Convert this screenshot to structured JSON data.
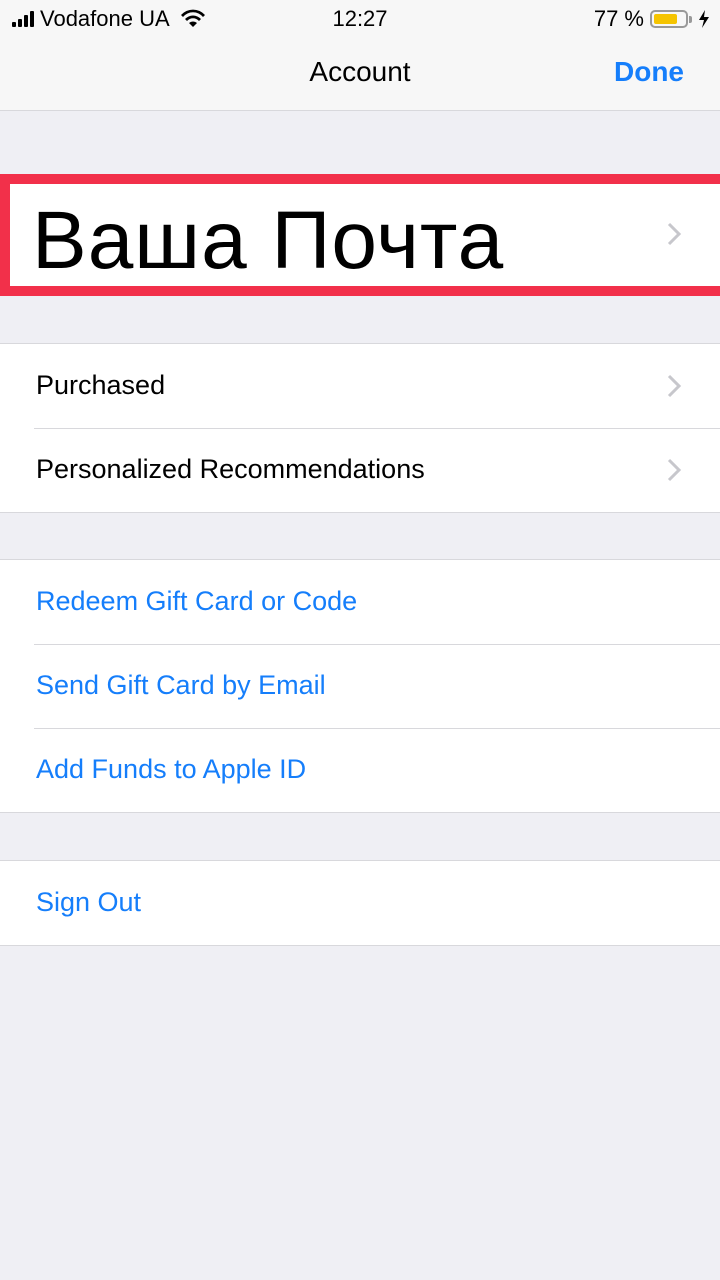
{
  "status_bar": {
    "carrier": "Vodafone UA",
    "time": "12:27",
    "battery_percent_text": "77 %",
    "battery_level": 0.77,
    "battery_color": "#f5c400"
  },
  "nav": {
    "title": "Account",
    "done_label": "Done"
  },
  "account": {
    "name": "Ваша Почта",
    "highlight_color": "#f2304a"
  },
  "groups": [
    {
      "items": [
        {
          "label": "Purchased",
          "style": "default",
          "chevron": true
        },
        {
          "label": "Personalized Recommendations",
          "style": "default",
          "chevron": true
        }
      ]
    },
    {
      "items": [
        {
          "label": "Redeem Gift Card or Code",
          "style": "link"
        },
        {
          "label": "Send Gift Card by Email",
          "style": "link"
        },
        {
          "label": "Add Funds to Apple ID",
          "style": "link"
        }
      ]
    },
    {
      "items": [
        {
          "label": "Sign Out",
          "style": "link"
        }
      ]
    }
  ],
  "colors": {
    "accent": "#157efb",
    "background": "#efeff4"
  }
}
